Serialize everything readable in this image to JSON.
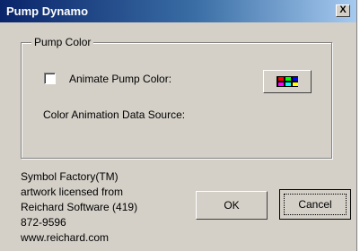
{
  "window": {
    "title": "Pump Dynamo",
    "close_label": "X"
  },
  "group": {
    "label": "Pump Color",
    "animate_label": "Animate Pump Color:",
    "animate_checked": false,
    "source_label": "Color Animation Data Source:"
  },
  "color_button": {
    "icon": "color-grid-icon",
    "swatch_colors": [
      "#ff0000",
      "#00ff00",
      "#0000ff",
      "#ff00ff",
      "#00ffff",
      "#ffff00"
    ]
  },
  "info": {
    "line1": "Symbol Factory(TM)",
    "line2": "artwork licensed from",
    "line3": "Reichard Software (419)",
    "line4": "872-9596",
    "line5": "www.reichard.com"
  },
  "buttons": {
    "ok": "OK",
    "cancel": "Cancel"
  },
  "colors": {
    "titlebar": "#0a246a",
    "face": "#d4d0c8"
  }
}
